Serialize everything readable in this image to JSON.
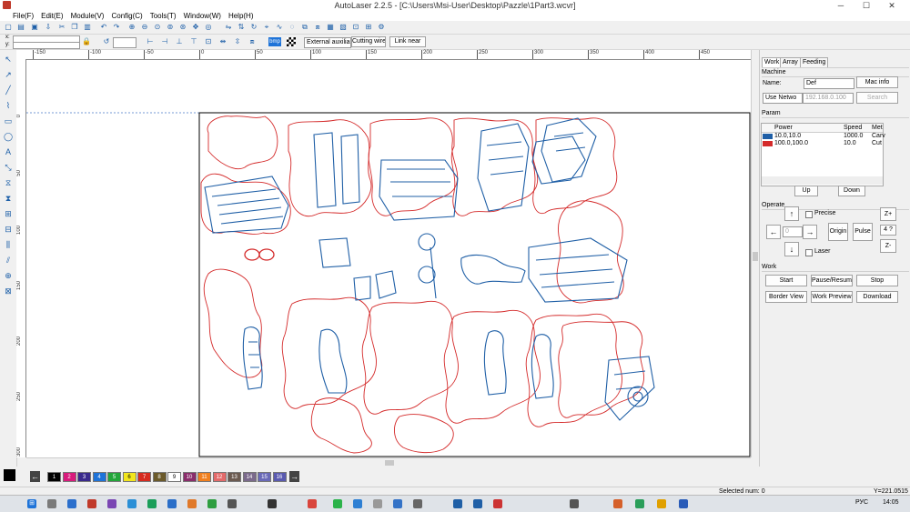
{
  "window": {
    "title": "AutoLaser 2.2.5 - [C:\\Users\\Msi-User\\Desktop\\Pazzle\\1Part3.wcvr]",
    "minimize": "─",
    "maximize": "☐",
    "close": "✕"
  },
  "menu": [
    "File(F)",
    "Edit(E)",
    "Module(V)",
    "Config(C)",
    "Tools(T)",
    "Window(W)",
    "Help(H)"
  ],
  "toolbar2": {
    "x_label": "x:",
    "y_label": "y:",
    "bmp_label": "bmp",
    "dropdown_value": "External auxilia",
    "cutting_wire": "Cutting wire",
    "link_near": "Link near"
  },
  "rulers": {
    "h_ticks": [
      "-150",
      "-100",
      "-50",
      "0",
      "50",
      "100",
      "150",
      "200",
      "250",
      "300",
      "350",
      "400",
      "450"
    ],
    "v_ticks": [
      "0",
      "50",
      "100",
      "150",
      "200",
      "250",
      "300"
    ]
  },
  "panel": {
    "tabs": [
      "Work",
      "Array",
      "Feeding"
    ],
    "machine": {
      "section": "Machine",
      "name_label": "Name:",
      "name_value": "Def",
      "mac_info": "Mac info",
      "network_select": "Use Netwo",
      "ip_value": "192.168.0.100",
      "search": "Search"
    },
    "param": {
      "section": "Param",
      "headers": [
        "Power",
        "Speed",
        "Met"
      ],
      "rows": [
        {
          "color": "#1f5fa6",
          "power": "10.0,10.0",
          "speed": "1000.0",
          "mode": "Carv"
        },
        {
          "color": "#d42a2a",
          "power": "100.0,100.0",
          "speed": "10.0",
          "mode": "Cut"
        }
      ],
      "up": "Up",
      "down": "Down"
    },
    "operate": {
      "section": "Operate",
      "precise": "Precise",
      "laser": "Laser",
      "step_value": "0",
      "origin": "Origin",
      "pulse": "Pulse",
      "z_up": "Z+",
      "z_step": "4 ?",
      "z_down": "Z-"
    },
    "work": {
      "section": "Work",
      "start": "Start",
      "pause": "Pause/Resume",
      "stop": "Stop",
      "border_view": "Border View",
      "work_preview": "Work Preview",
      "download": "Download"
    }
  },
  "layers": [
    {
      "n": "1",
      "color": "#000000"
    },
    {
      "n": "2",
      "color": "#d81b7c"
    },
    {
      "n": "3",
      "color": "#3a2a8c"
    },
    {
      "n": "4",
      "color": "#1e73d8"
    },
    {
      "n": "5",
      "color": "#23a63a"
    },
    {
      "n": "6",
      "color": "#f2e51c"
    },
    {
      "n": "7",
      "color": "#d62b1f"
    },
    {
      "n": "8",
      "color": "#6b5a2a"
    },
    {
      "n": "9",
      "color": "#ffffff"
    },
    {
      "n": "10",
      "color": "#8a2d6b"
    },
    {
      "n": "11",
      "color": "#f07f1e"
    },
    {
      "n": "12",
      "color": "#e36a6a"
    },
    {
      "n": "13",
      "color": "#6b5a50"
    },
    {
      "n": "14",
      "color": "#7b6a8c"
    },
    {
      "n": "15",
      "color": "#6a6ab8"
    },
    {
      "n": "16",
      "color": "#5a5ab0"
    }
  ],
  "status": {
    "selected": "Selected num: 0",
    "coord": "Y=221.0515"
  },
  "taskbar": {
    "lang": "РУС",
    "time": "14:05"
  },
  "colors": {
    "cut": "#d42a2a",
    "carve": "#1f5fa6",
    "accent": "#1d5fa8"
  }
}
